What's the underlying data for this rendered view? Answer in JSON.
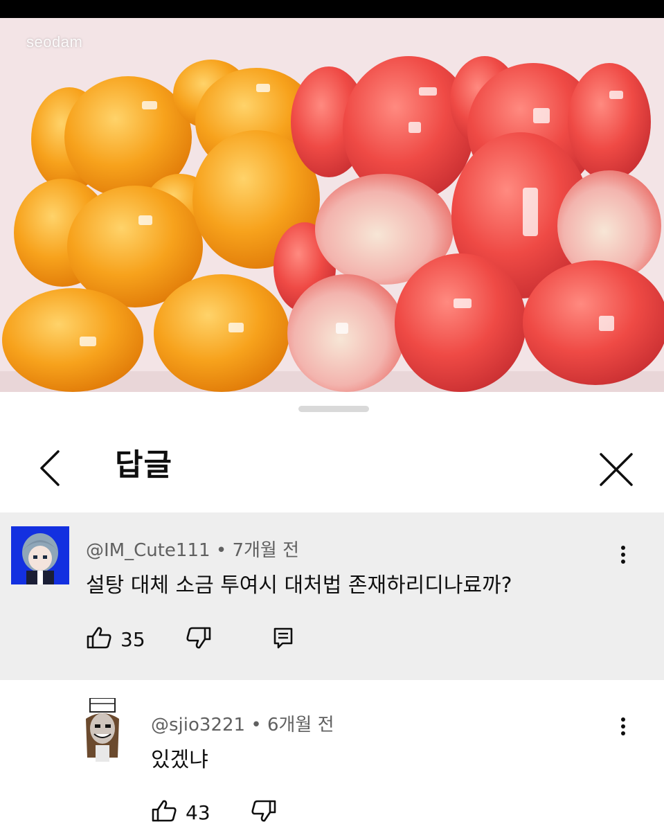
{
  "video": {
    "watermark": "seodam"
  },
  "sheet": {
    "title": "답글",
    "back_icon": "chevron-left-icon",
    "close_icon": "close-icon"
  },
  "comment": {
    "author": "@IM_Cute111",
    "separator": "•",
    "time": "7개월 전",
    "text": "설탕 대체 소금 투여시 대처법 존재하리디나료까?",
    "likes": "35",
    "avatar_color": "#1330e0"
  },
  "reply": {
    "author": "@sjio3221",
    "separator": "•",
    "time": "6개월 전",
    "text": "있겠냐",
    "likes": "43"
  },
  "icons": [
    "thumbs-up-icon",
    "thumbs-down-icon",
    "reply-icon",
    "more-vertical-icon"
  ]
}
